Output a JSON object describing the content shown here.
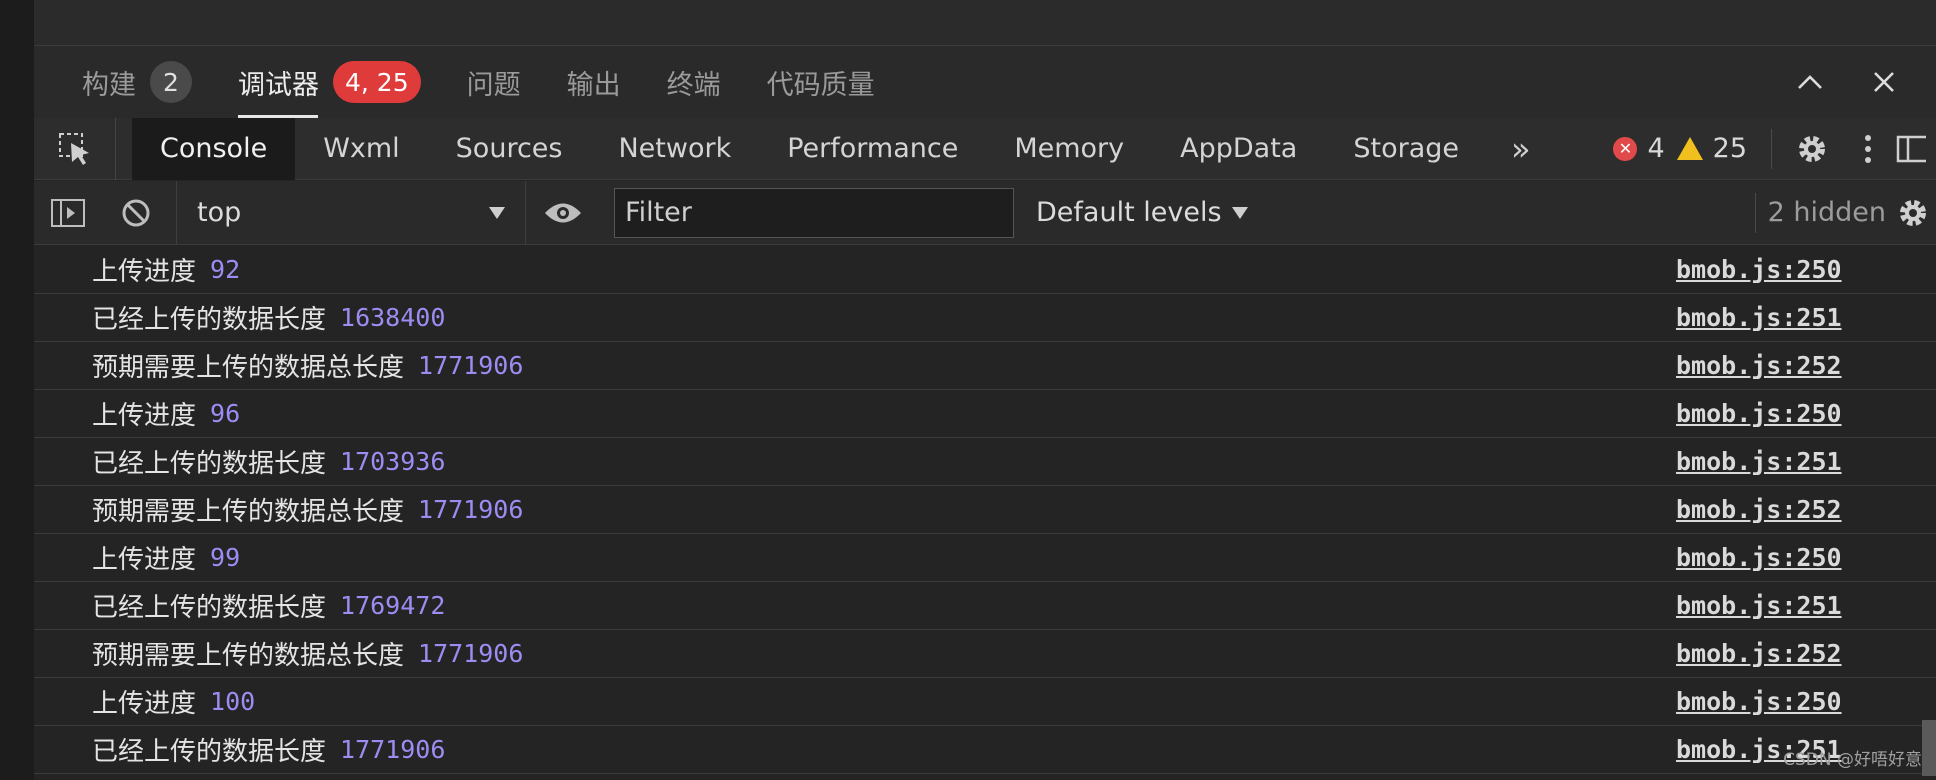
{
  "panel_tabs": [
    {
      "label": "构建",
      "badge": "2",
      "active": false,
      "badge_color": "#4a4a4a"
    },
    {
      "label": "调试器",
      "badge": "4, 25",
      "active": true,
      "badge_color": "#e03b3b"
    },
    {
      "label": "问题",
      "active": false
    },
    {
      "label": "输出",
      "active": false
    },
    {
      "label": "终端",
      "active": false
    },
    {
      "label": "代码质量",
      "active": false
    }
  ],
  "devtools_tabs": [
    "Console",
    "Wxml",
    "Sources",
    "Network",
    "Performance",
    "Memory",
    "AppData",
    "Storage"
  ],
  "active_devtools_tab": "Console",
  "more_tabs": "»",
  "status": {
    "errors": "4",
    "warnings": "25"
  },
  "toolbar": {
    "context": "top",
    "filter_placeholder": "Filter",
    "levels": "Default levels",
    "hidden": "2 hidden"
  },
  "console_rows": [
    {
      "message": "上传进度",
      "value": "92",
      "source": "bmob.js:250"
    },
    {
      "message": "已经上传的数据长度",
      "value": "1638400",
      "source": "bmob.js:251"
    },
    {
      "message": "预期需要上传的数据总长度",
      "value": "1771906",
      "source": "bmob.js:252"
    },
    {
      "message": "上传进度",
      "value": "96",
      "source": "bmob.js:250"
    },
    {
      "message": "已经上传的数据长度",
      "value": "1703936",
      "source": "bmob.js:251"
    },
    {
      "message": "预期需要上传的数据总长度",
      "value": "1771906",
      "source": "bmob.js:252"
    },
    {
      "message": "上传进度",
      "value": "99",
      "source": "bmob.js:250"
    },
    {
      "message": "已经上传的数据长度",
      "value": "1769472",
      "source": "bmob.js:251"
    },
    {
      "message": "预期需要上传的数据总长度",
      "value": "1771906",
      "source": "bmob.js:252"
    },
    {
      "message": "上传进度",
      "value": "100",
      "source": "bmob.js:250"
    },
    {
      "message": "已经上传的数据长度",
      "value": "1771906",
      "source": "bmob.js:251"
    }
  ],
  "watermark": "CSDN @好唔好意"
}
